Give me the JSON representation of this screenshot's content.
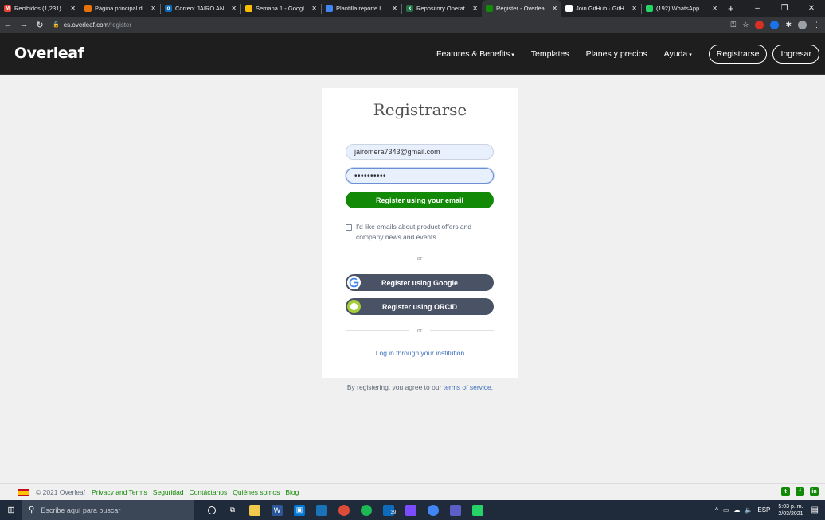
{
  "browser": {
    "tabs": [
      {
        "title": "Recibidos (1,231)",
        "favicon_color": "#ea4335",
        "favicon_glyph": "M",
        "active": false
      },
      {
        "title": "Página principal d",
        "favicon_color": "#e8710a",
        "favicon_glyph": "",
        "active": false
      },
      {
        "title": "Correo: JAIRO AN",
        "favicon_color": "#0f6cbd",
        "favicon_glyph": "o",
        "active": false
      },
      {
        "title": "Semana 1 - Googl",
        "favicon_color": "#fbbc04",
        "favicon_glyph": "",
        "active": false
      },
      {
        "title": "Plantilla reporte L",
        "favicon_color": "#4285f4",
        "favicon_glyph": "",
        "active": false
      },
      {
        "title": "Repository Operat",
        "favicon_color": "#217346",
        "favicon_glyph": "x",
        "active": false
      },
      {
        "title": "Register - Overlea",
        "favicon_color": "#138a07",
        "favicon_glyph": "",
        "active": true
      },
      {
        "title": "Join GitHub · GitH",
        "favicon_color": "#ffffff",
        "favicon_glyph": "",
        "active": false
      },
      {
        "title": "(192) WhatsApp",
        "favicon_color": "#25d366",
        "favicon_glyph": "",
        "active": false
      }
    ],
    "url_domain": "es.overleaf.com",
    "url_path": "/register"
  },
  "header": {
    "logo": "Overleaf",
    "nav": {
      "features": "Features & Benefits",
      "templates": "Templates",
      "pricing": "Planes y precios",
      "help": "Ayuda"
    },
    "register_label": "Registrarse",
    "login_label": "Ingresar"
  },
  "register": {
    "title": "Registrarse",
    "email_value": "jairomera7343@gmail.com",
    "password_value": "••••••••••",
    "register_email_button": "Register using your email",
    "newsletter_line1": "I'd like emails about product offers and",
    "newsletter_line2": "company news and events.",
    "or_label": "or",
    "google_button": "Register using Google",
    "orcid_button": "Register using ORCID",
    "institution_link": "Log in through your institution",
    "tos_prefix": "By registering, you agree to our",
    "tos_link": "terms of service."
  },
  "footer": {
    "copyright": "© 2021 Overleaf",
    "links": [
      "Privacy and Terms",
      "Seguridad",
      "Contáctanos",
      "Quiénes somos",
      "Blog"
    ]
  },
  "taskbar": {
    "search_placeholder": "Escribe aquí para buscar",
    "language": "ESP",
    "time": "5:03 p. m.",
    "date": "2/03/2021",
    "badge": "39"
  },
  "colors": {
    "overleaf_green": "#138a07",
    "header_bg": "#1e1e1e",
    "dark_button": "#495365",
    "link_blue": "#3e70bb"
  }
}
